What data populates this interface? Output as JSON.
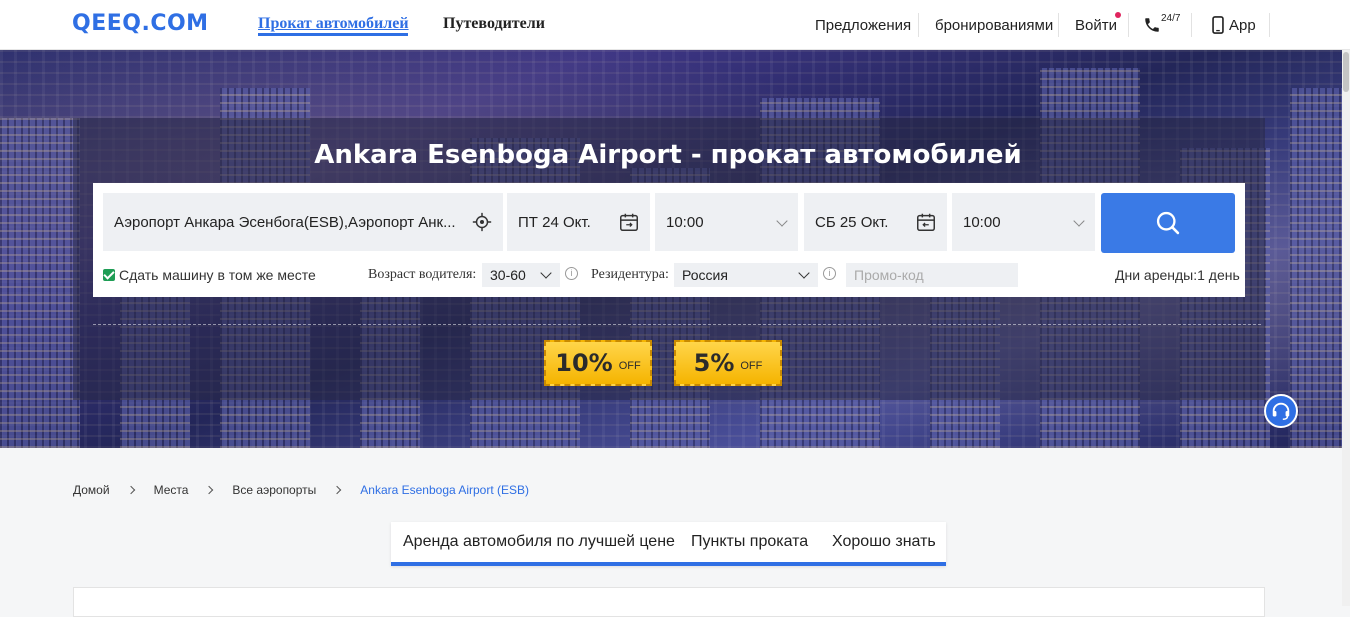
{
  "header": {
    "logo": "QEEQ.COM",
    "nav_rental": "Прокат автомобилей",
    "nav_guides": "Путеводители",
    "offers": "Предложения",
    "bookings": "бронированиями",
    "login": "Войти",
    "support_24": "24/7",
    "app": "App"
  },
  "hero": {
    "title": "Ankara Esenboga Airport - прокат автомобилей"
  },
  "search": {
    "pickup_location": "Аэропорт Анкара Эсенбога(ESB),Аэропорт Анк...",
    "pickup_date": "ПТ 24 Окт.",
    "pickup_time": "10:00",
    "return_date": "СБ 25 Окт.",
    "return_time": "10:00",
    "same_place": "Сдать машину в том же месте",
    "driver_age_label": "Возраст водителя:",
    "driver_age_value": "30-60",
    "residence_label": "Резидентура:",
    "residence_value": "Россия",
    "promo_placeholder": "Промо-код",
    "rental_days": "Дни аренды:1 день"
  },
  "coupons": [
    {
      "pct": "10%",
      "off": "OFF"
    },
    {
      "pct": "5%",
      "off": "OFF"
    }
  ],
  "breadcrumb": {
    "home": "Домой",
    "places": "Места",
    "airports": "Все аэропорты",
    "current": "Ankara Esenboga Airport (ESB)"
  },
  "tabs": {
    "best_price": "Аренда автомобиля по лучшей цене",
    "locations": "Пункты проката",
    "good_to_know": "Хорошо знать"
  },
  "colors": {
    "accent": "#2f6fe4",
    "coupon": "#f5b400"
  }
}
